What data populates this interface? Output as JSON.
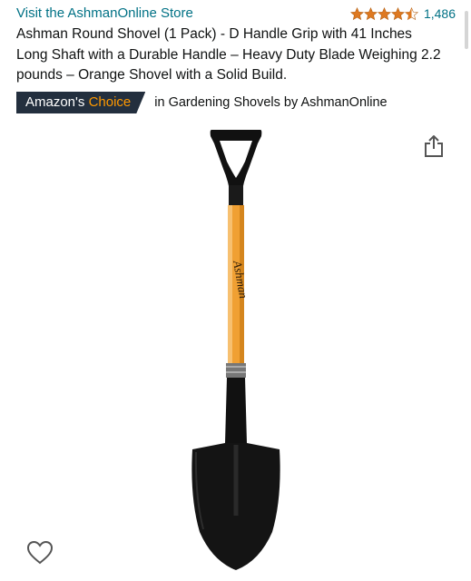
{
  "store": {
    "link_text": "Visit the AshmanOnline Store",
    "rating": 4.5,
    "review_count": "1,486",
    "star_color": "#de7921"
  },
  "product": {
    "title": "Ashman Round Shovel (1 Pack) - D Handle Grip with 41 Inches Long Shaft with a Durable Handle – Heavy Duty Blade Weighing 2.2 pounds – Orange Shovel with a Solid Build.",
    "handle_brand_text": "Ashman"
  },
  "badge": {
    "prefix": "Amazon's",
    "highlight": "Choice",
    "category_text": "in Gardening Shovels by AshmanOnline"
  },
  "icons": {
    "share": "share-icon",
    "wishlist": "heart-icon",
    "star": "star-icon"
  },
  "colors": {
    "link": "#007185",
    "badge_bg": "#232f3e",
    "badge_accent": "#ff9900",
    "shaft": "#f0a033"
  }
}
